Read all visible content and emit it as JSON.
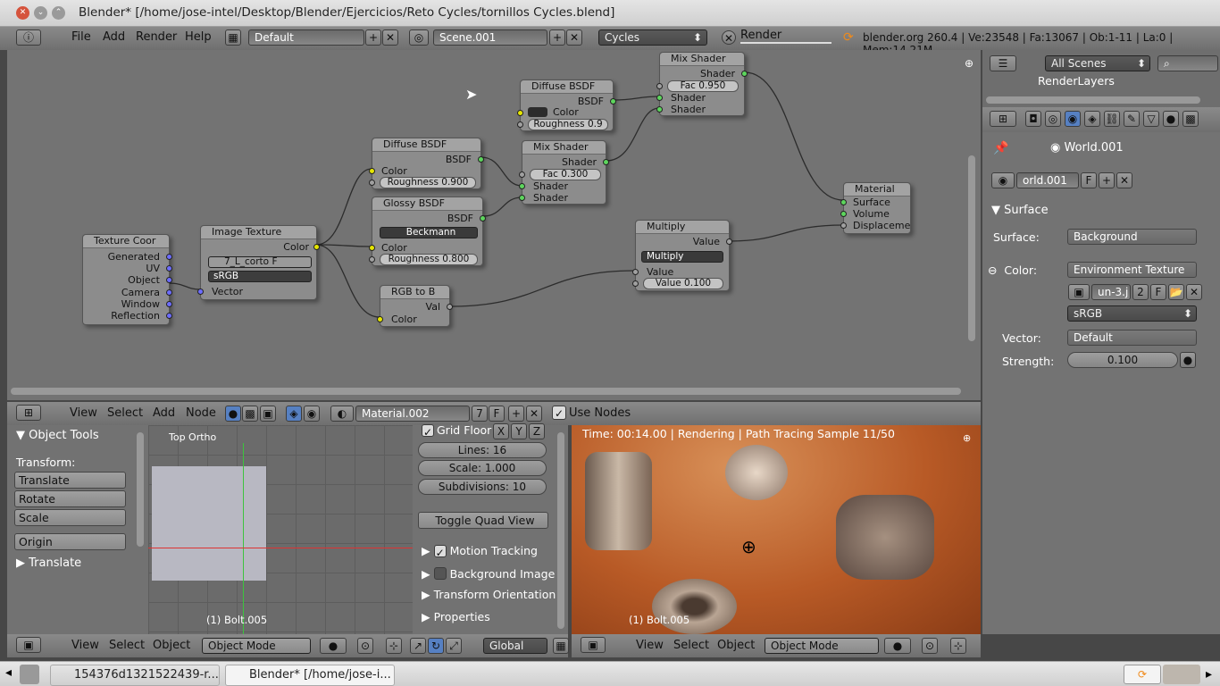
{
  "window": {
    "title": "Blender* [/home/jose-intel/Desktop/Blender/Ejercicios/Reto Cycles/tornillos Cycles.blend]"
  },
  "info_header": {
    "menus": [
      "File",
      "Add",
      "Render",
      "Help"
    ],
    "layout": "Default",
    "scene": "Scene.001",
    "engine": "Cycles",
    "render_label": "Render",
    "stats": "blender.org 260.4 | Ve:23548 | Fa:13067 | Ob:1-11 | La:0 | Mem:14.21M"
  },
  "nodes": {
    "texture_coord": {
      "title": "Texture Coor",
      "outputs": [
        "Generated",
        "UV",
        "Object",
        "Camera",
        "Window",
        "Reflection"
      ]
    },
    "image_texture": {
      "title": "Image Texture",
      "out": "Color",
      "file": "7_L_corto",
      "flag": "F",
      "color_space": "sRGB",
      "input": "Vector"
    },
    "diffuse1": {
      "title": "Diffuse BSDF",
      "out": "BSDF",
      "in": "Color",
      "roughness": "Roughness 0.900"
    },
    "glossy": {
      "title": "Glossy BSDF",
      "out": "BSDF",
      "dist": "Beckmann",
      "in": "Color",
      "roughness": "Roughness 0.800"
    },
    "rgb_to_bw": {
      "title": "RGB to B",
      "out": "Val",
      "in": "Color"
    },
    "diffuse2": {
      "title": "Diffuse BSDF",
      "out": "BSDF",
      "in": "Color",
      "roughness": "Roughness 0.9"
    },
    "mix1": {
      "title": "Mix Shader",
      "out": "Shader",
      "fac": "Fac 0.300",
      "in1": "Shader",
      "in2": "Shader"
    },
    "mix2": {
      "title": "Mix Shader",
      "out": "Shader",
      "fac": "Fac 0.950",
      "in1": "Shader",
      "in2": "Shader"
    },
    "multiply": {
      "title": "Multiply",
      "out": "Value",
      "op": "Multiply",
      "in": "Value",
      "value": "Value 0.100"
    },
    "material": {
      "title": "Material",
      "inputs": [
        "Surface",
        "Volume",
        "Displaceme"
      ]
    }
  },
  "node_header": {
    "menus": [
      "View",
      "Select",
      "Add",
      "Node"
    ],
    "material": "Material.002",
    "users": "7",
    "flag": "F",
    "use_nodes": "Use Nodes"
  },
  "outliner": {
    "filter": "All Scenes",
    "item": "RenderLayers"
  },
  "properties": {
    "breadcrumb": "World.001",
    "world_field": "orld.001",
    "flag": "F",
    "panel": "Surface",
    "surface_label": "Surface:",
    "surface_value": "Background",
    "color_label": "Color:",
    "color_value": "Environment Texture",
    "image_name": "un-3.j",
    "image_users": "2",
    "image_flag": "F",
    "color_space": "sRGB",
    "vector_label": "Vector:",
    "vector_value": "Default",
    "strength_label": "Strength:",
    "strength_value": "0.100"
  },
  "tool_shelf": {
    "title": "Object Tools",
    "transform_label": "Transform:",
    "buttons": [
      "Translate",
      "Rotate",
      "Scale"
    ],
    "origin": "Origin",
    "subpanel": "Translate"
  },
  "viewport_left": {
    "label": "Top Ortho",
    "object": "(1) Bolt.005"
  },
  "display_panel": {
    "grid_floor": "Grid Floor",
    "axes": [
      "X",
      "Y",
      "Z"
    ],
    "lines": "Lines: 16",
    "scale": "Scale: 1.000",
    "subdivisions": "Subdivisions: 10",
    "toggle_quad": "Toggle Quad View",
    "motion_tracking": "Motion Tracking",
    "background_image": "Background Image",
    "transform_orientation": "Transform Orientation",
    "properties": "Properties"
  },
  "viewport_render": {
    "status": "Time: 00:14.00 | Rendering | Path Tracing Sample 11/50",
    "object": "(1) Bolt.005"
  },
  "bottom_header": {
    "menus": [
      "View",
      "Select",
      "Object"
    ],
    "mode": "Object Mode",
    "orientation": "Global"
  },
  "taskbar": {
    "items": [
      "154376d1321522439-r...",
      "Blender* [/home/jose-i..."
    ]
  },
  "colors": {
    "node_bg": "#737373",
    "header": "#7a7a7a",
    "socket_yellow": "#e6e600",
    "socket_green": "#5dd55d"
  }
}
